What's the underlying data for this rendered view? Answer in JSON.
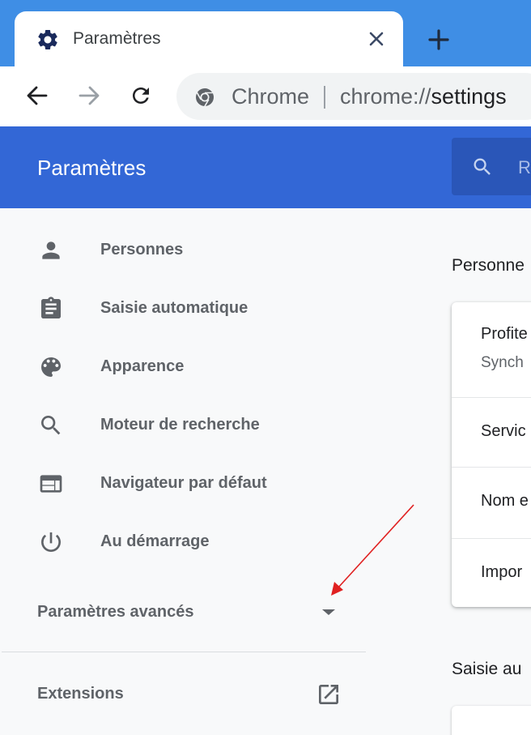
{
  "tab": {
    "title": "Paramètres",
    "icon": "gear-icon",
    "close_icon": "close-icon"
  },
  "new_tab_icon": "plus-icon",
  "toolbar": {
    "back_icon": "back-arrow-icon",
    "forward_icon": "forward-arrow-icon",
    "reload_icon": "reload-icon",
    "omnibox": {
      "site": "Chrome",
      "url_scheme": "chrome://",
      "url_path": "settings"
    }
  },
  "header": {
    "title": "Paramètres",
    "search_placeholder": "R"
  },
  "sidebar": {
    "items": [
      {
        "label": "Personnes",
        "icon": "person-icon"
      },
      {
        "label": "Saisie automatique",
        "icon": "clipboard-icon"
      },
      {
        "label": "Apparence",
        "icon": "palette-icon"
      },
      {
        "label": "Moteur de recherche",
        "icon": "search-icon"
      },
      {
        "label": "Navigateur par défaut",
        "icon": "browser-window-icon"
      },
      {
        "label": "Au démarrage",
        "icon": "power-icon"
      }
    ],
    "advanced_label": "Paramètres avancés",
    "extensions_label": "Extensions"
  },
  "main": {
    "section1_title": "Personne",
    "rows": [
      {
        "title": "Profite",
        "subtitle": "Synch"
      },
      {
        "title": "Servic"
      },
      {
        "title": "Nom e"
      },
      {
        "title": "Impor"
      }
    ],
    "section2_title": "Saisie au"
  },
  "colors": {
    "tabstrip": "#3f8ee5",
    "header": "#3367d6",
    "annotation_arrow": "#e02020"
  }
}
